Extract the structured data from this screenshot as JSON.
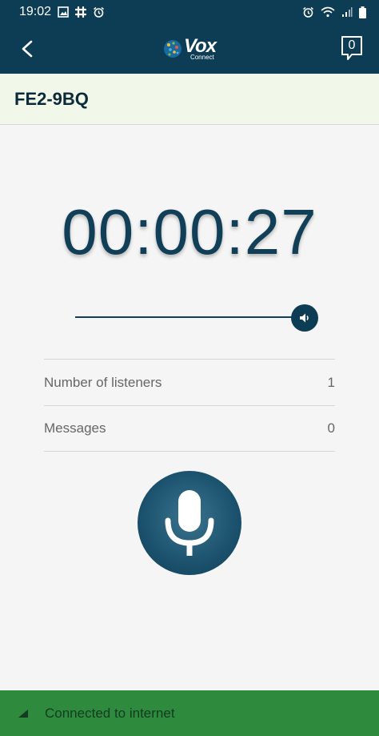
{
  "status_bar": {
    "time": "19:02",
    "left_icons": [
      "image-icon",
      "slack-icon",
      "alarm-icon"
    ],
    "right_icons": [
      "alarm-icon",
      "wifi-icon",
      "signal-icon",
      "battery-icon"
    ]
  },
  "app_bar": {
    "logo_main": "Vox",
    "logo_sub": "Connect",
    "message_count": "0"
  },
  "channel": {
    "name": "FE2-9BQ"
  },
  "timer": {
    "elapsed": "00:00:27"
  },
  "volume": {
    "level": 1.0
  },
  "info": {
    "listeners_label": "Number of listeners",
    "listeners_value": "1",
    "messages_label": "Messages",
    "messages_value": "0"
  },
  "footer": {
    "status_text": "Connected to internet"
  },
  "colors": {
    "header": "#0d3c55",
    "channel_bg": "#f1f8e9",
    "timer_text": "#123f58",
    "footer": "#2e8b3e"
  }
}
